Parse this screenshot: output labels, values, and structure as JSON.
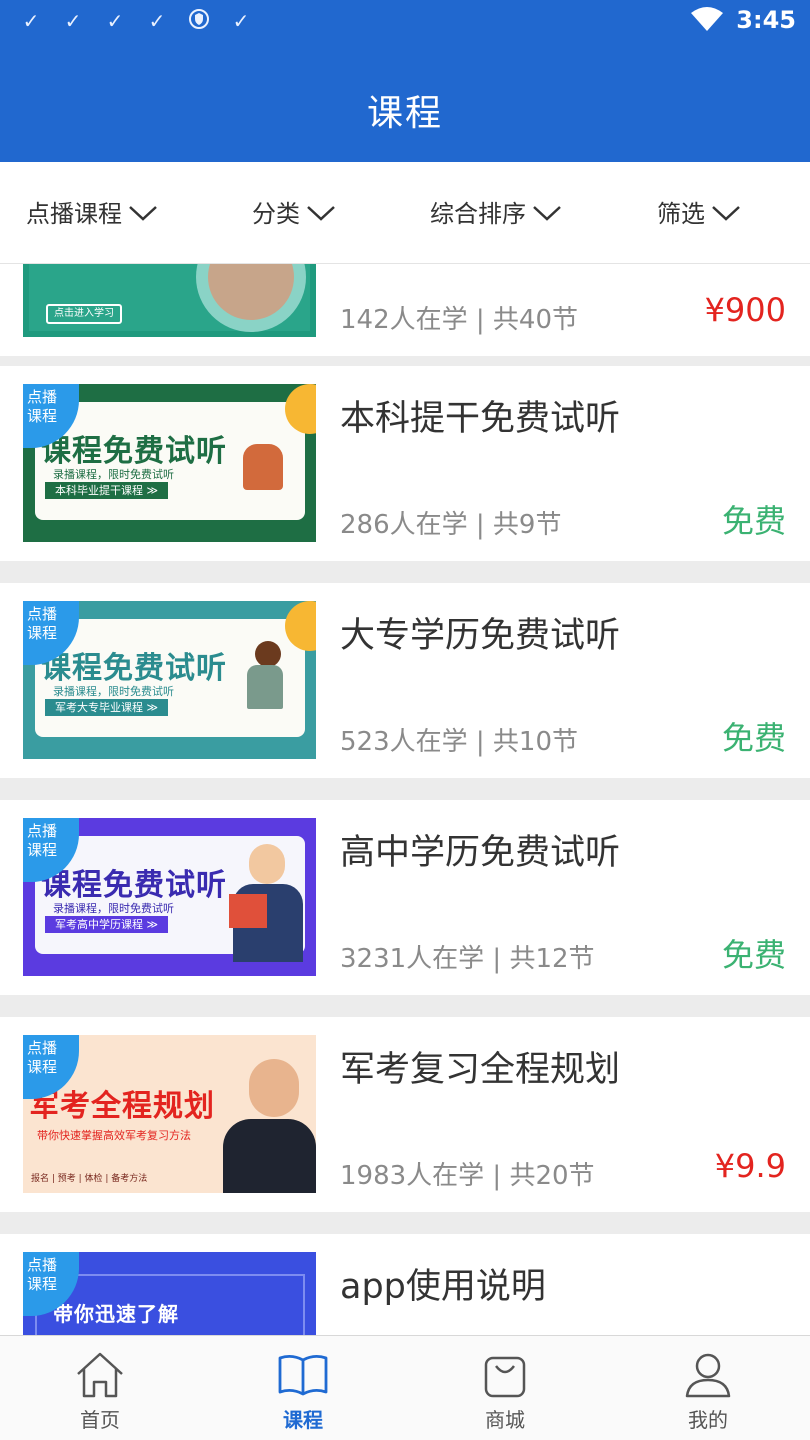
{
  "status": {
    "time": "3:45",
    "icons": [
      "check-icon",
      "check-icon",
      "check-icon",
      "check-icon",
      "shield-icon",
      "check-icon"
    ]
  },
  "header": {
    "title": "课程"
  },
  "filters": [
    {
      "label": "点播课程"
    },
    {
      "label": "分类"
    },
    {
      "label": "综合排序"
    },
    {
      "label": "筛选"
    }
  ],
  "partial_card": {
    "banner_button": "点击进入学习",
    "meta": "142人在学 | 共40节",
    "price": "¥900"
  },
  "courses": [
    {
      "tag": "点播\n课程",
      "banner_title": "课程免费试听",
      "banner_sub": "录播课程，限时免费试听",
      "banner_pill": "本科毕业提干课程  ≫",
      "title": "本科提干免费试听",
      "meta": "286人在学 | 共9节",
      "price": "免费",
      "accent": "#1e6e44"
    },
    {
      "tag": "点播\n课程",
      "banner_title": "课程免费试听",
      "banner_sub": "录播课程，限时免费试听",
      "banner_pill": "军考大专毕业课程  ≫",
      "title": "大专学历免费试听",
      "meta": "523人在学 | 共10节",
      "price": "免费",
      "accent": "#3a9da1"
    },
    {
      "tag": "点播\n课程",
      "banner_title": "课程免费试听",
      "banner_sub": "录播课程，限时免费试听",
      "banner_pill": "军考高中学历课程  ≫",
      "title": "高中学历免费试听",
      "meta": "3231人在学 | 共12节",
      "price": "免费",
      "accent": "#5b3be0"
    },
    {
      "tag": "点播\n课程",
      "banner_title": "军考全程规划",
      "banner_sub": "带你快速掌握高效军考复习方法",
      "banner_pill": "报名 | 预考 | 体检 | 备考方法",
      "title": "军考复习全程规划",
      "meta": "1983人在学 | 共20节",
      "price": "¥9.9",
      "accent": "#f5c9a4"
    },
    {
      "tag": "点播\n课程",
      "banner_title": "带你迅速了解",
      "banner_sub": "",
      "banner_pill": "",
      "title": "app使用说明",
      "meta": "",
      "price": "",
      "accent": "#3a4fe0"
    }
  ],
  "tabbar": [
    {
      "label": "首页",
      "icon": "home-icon"
    },
    {
      "label": "课程",
      "icon": "book-icon",
      "active": true
    },
    {
      "label": "商城",
      "icon": "bag-icon"
    },
    {
      "label": "我的",
      "icon": "user-icon"
    }
  ],
  "colors": {
    "primary": "#2168cf",
    "free": "#3bb272",
    "price": "#e3241f"
  }
}
